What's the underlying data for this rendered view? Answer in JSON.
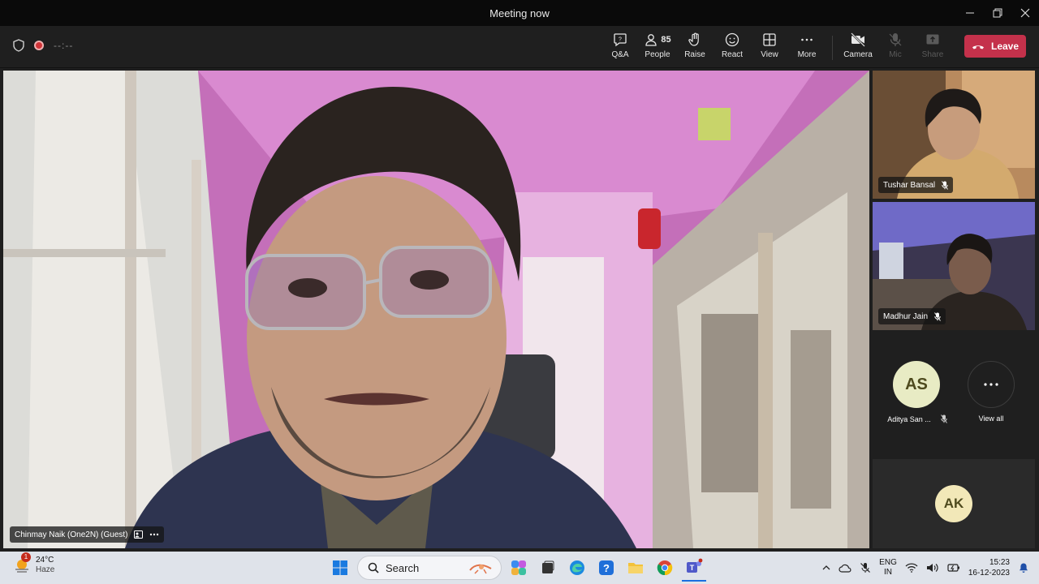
{
  "window": {
    "title": "Meeting now",
    "controls": [
      "minimize",
      "restore",
      "close"
    ]
  },
  "toolbar": {
    "timer": "--:--",
    "buttons": [
      {
        "label": "Q&A",
        "icon": "qa-icon",
        "enabled": true
      },
      {
        "label": "People",
        "icon": "people-icon",
        "count": "85",
        "enabled": true
      },
      {
        "label": "Raise",
        "icon": "raise-hand-icon",
        "enabled": true
      },
      {
        "label": "React",
        "icon": "smiley-icon",
        "enabled": true
      },
      {
        "label": "View",
        "icon": "grid-icon",
        "enabled": true
      },
      {
        "label": "More",
        "icon": "ellipsis-icon",
        "enabled": true
      },
      {
        "label": "Camera",
        "icon": "camera-off-icon",
        "enabled": true
      },
      {
        "label": "Mic",
        "icon": "mic-off-icon",
        "enabled": false
      },
      {
        "label": "Share",
        "icon": "share-icon",
        "enabled": false
      }
    ],
    "leave_label": "Leave",
    "leave_color": "#c4314b"
  },
  "main_video": {
    "participant": "Chinmay Naik (One2N) (Guest)"
  },
  "side_tiles": [
    {
      "name": "Tushar Bansal",
      "muted": true
    },
    {
      "name": "Madhur Jain",
      "muted": true
    }
  ],
  "avatars": [
    {
      "initials": "AS",
      "name": "Aditya San ...",
      "muted": true,
      "color": "#e8ebc4"
    },
    {
      "initials": "⋯",
      "name": "View all"
    }
  ],
  "self_tile": {
    "initials": "AK",
    "color": "#f2e8b8"
  },
  "taskbar": {
    "weather_temp": "24°C",
    "weather_desc": "Haze",
    "weather_badge": "1",
    "search_placeholder": "Search",
    "language_line1": "ENG",
    "language_line2": "IN",
    "time": "15:23",
    "date": "16-12-2023"
  }
}
